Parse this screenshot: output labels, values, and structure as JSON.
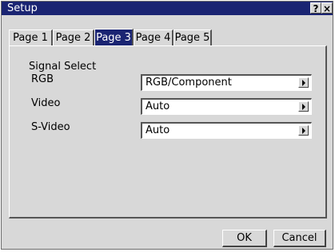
{
  "window": {
    "title": "Setup",
    "help_label": "?",
    "close_label": "×"
  },
  "tabs": [
    {
      "label": "Page 1",
      "active": false
    },
    {
      "label": "Page 2",
      "active": false
    },
    {
      "label": "Page 3",
      "active": true
    },
    {
      "label": "Page 4",
      "active": false
    },
    {
      "label": "Page 5",
      "active": false
    }
  ],
  "signal_select": {
    "heading": "Signal Select",
    "rows": [
      {
        "label": "RGB",
        "value": "RGB/Component"
      },
      {
        "label": "Video",
        "value": "Auto"
      },
      {
        "label": "S-Video",
        "value": "Auto"
      }
    ]
  },
  "buttons": {
    "ok": "OK",
    "cancel": "Cancel"
  },
  "colors": {
    "titlebar": "#1a2472",
    "face": "#d8d8d8",
    "field": "#ffffff"
  }
}
